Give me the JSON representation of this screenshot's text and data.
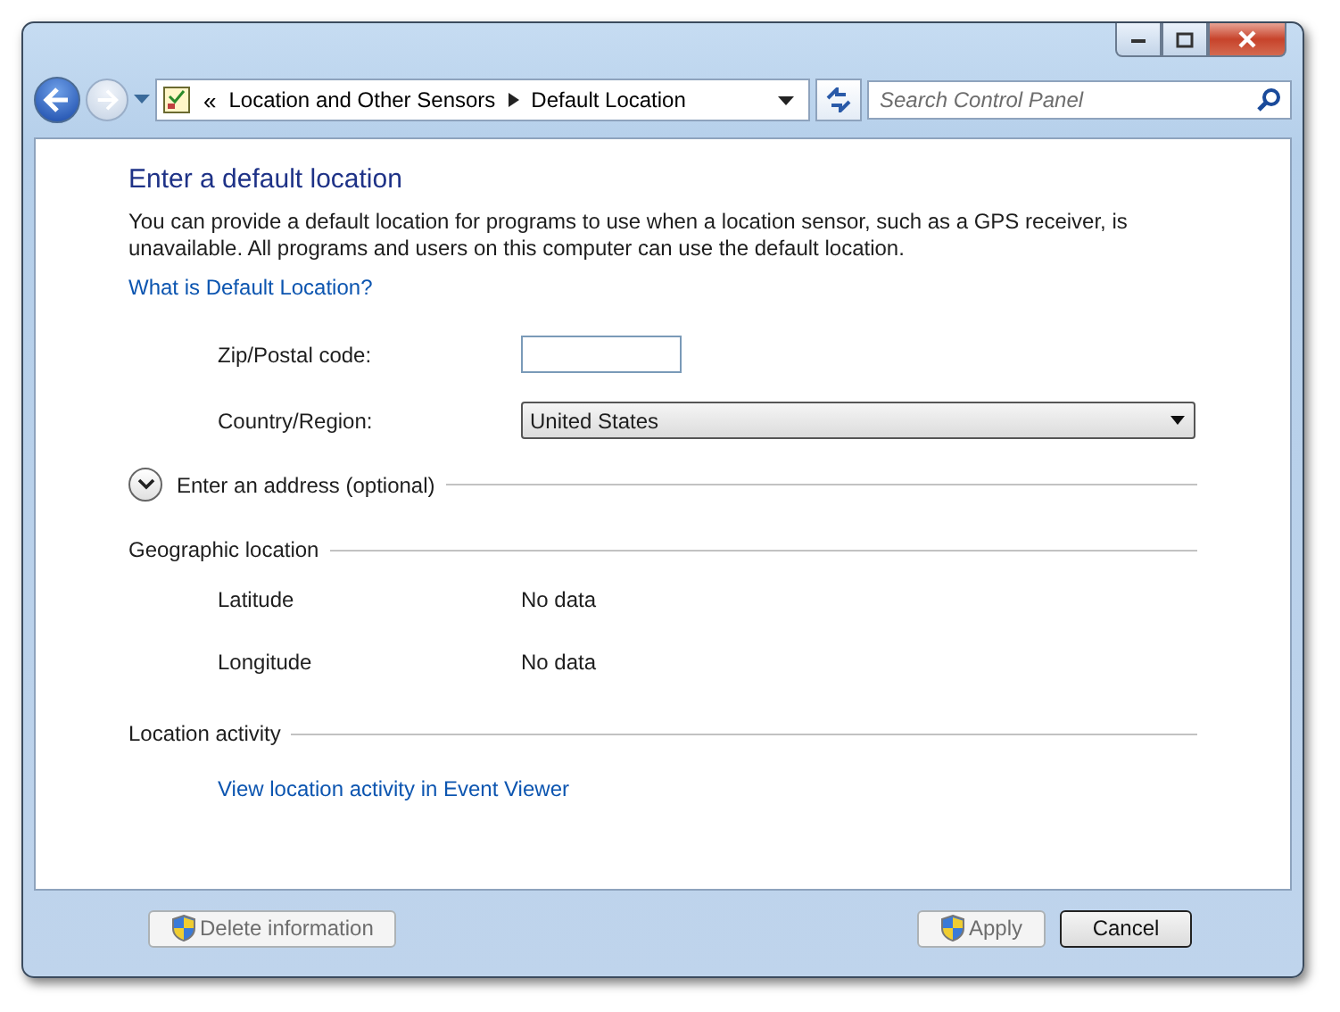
{
  "nav": {
    "back_disabled": false,
    "forward_disabled": true,
    "breadcrumb": [
      "Location and Other Sensors",
      "Default Location"
    ],
    "chevrons": "«",
    "search": {
      "placeholder": "Search Control Panel"
    }
  },
  "heading": "Enter a default location",
  "description": "You can provide a default location for programs to use when a location sensor, such as a GPS receiver, is unavailable. All programs and users on this computer can use the default location.",
  "help_link": "What is Default Location?",
  "form": [
    {
      "kind": "text",
      "label": "Zip/Postal code:"
    },
    {
      "kind": "select",
      "label": "Country/Region:",
      "value": "United States"
    }
  ],
  "address_section": {
    "label": "Enter an address (optional)",
    "expanded": false
  },
  "geo_section": {
    "label": "Geographic location",
    "rows": [
      {
        "label": "Latitude",
        "value": "No data"
      },
      {
        "label": "Longitude",
        "value": "No data"
      }
    ]
  },
  "activity_section": {
    "label": "Location activity",
    "link": "View location activity in Event Viewer"
  },
  "buttons": [
    {
      "label": "Delete information",
      "shield": true,
      "disabled": true,
      "default": false
    },
    {
      "label": "Apply",
      "shield": true,
      "disabled": true,
      "default": false
    },
    {
      "label": "Cancel",
      "shield": false,
      "disabled": false,
      "default": true
    }
  ]
}
